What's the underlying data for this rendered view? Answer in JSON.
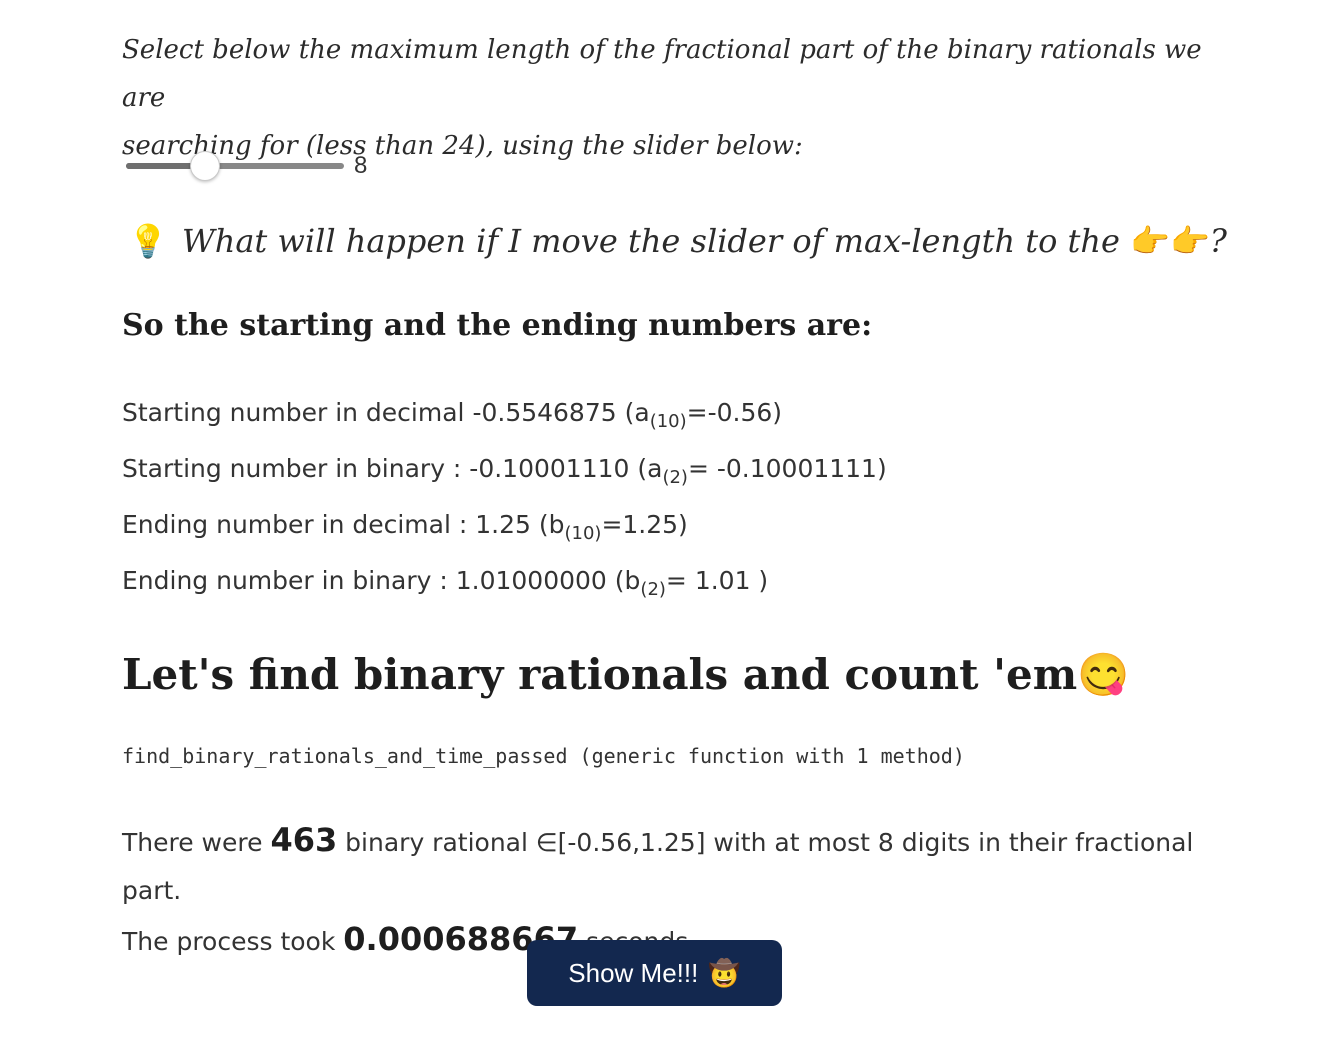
{
  "intro": {
    "line1": "Select below the maximum length of the fractional part of the binary rationals we are",
    "line2": "searching for (less than 24), using the slider below:"
  },
  "slider": {
    "value": "8",
    "fraction": 0.36
  },
  "question": {
    "bulb": "💡",
    "text": "What will happen if I move the slider of max-length to the ",
    "hands": "👉👉",
    "end": "?"
  },
  "subheading": "So the starting and the ending numbers are:",
  "numbers": {
    "start_dec_label": "Starting number in decimal -0.5546875 (a",
    "start_dec_sub": "(10)",
    "start_dec_rest": "=-0.56)",
    "start_bin_label": "Starting number in binary : -0.10001110 (a",
    "start_bin_sub": "(2)",
    "start_bin_rest": "= -0.10001111)",
    "end_dec_label": "Ending number in decimal : 1.25 (b",
    "end_dec_sub": "(10)",
    "end_dec_rest": "=1.25)",
    "end_bin_label": "Ending number in binary : 1.01000000 (b",
    "end_bin_sub": "(2)",
    "end_bin_rest": "= 1.01 )"
  },
  "heading": {
    "text": "Let's find binary rationals and count 'em",
    "emoji": "😋"
  },
  "code_output": "find_binary_rationals_and_time_passed (generic function with 1 method)",
  "result": {
    "pre": "There were ",
    "count": "463",
    "mid": " binary rational ∈[-0.56,1.25] with at most 8 digits in their fractional part.",
    "took_pre": "The process took ",
    "time": "0.000688667",
    "took_post": " seconds"
  },
  "button": {
    "label": "Show Me!!!",
    "emoji": "🤠"
  }
}
